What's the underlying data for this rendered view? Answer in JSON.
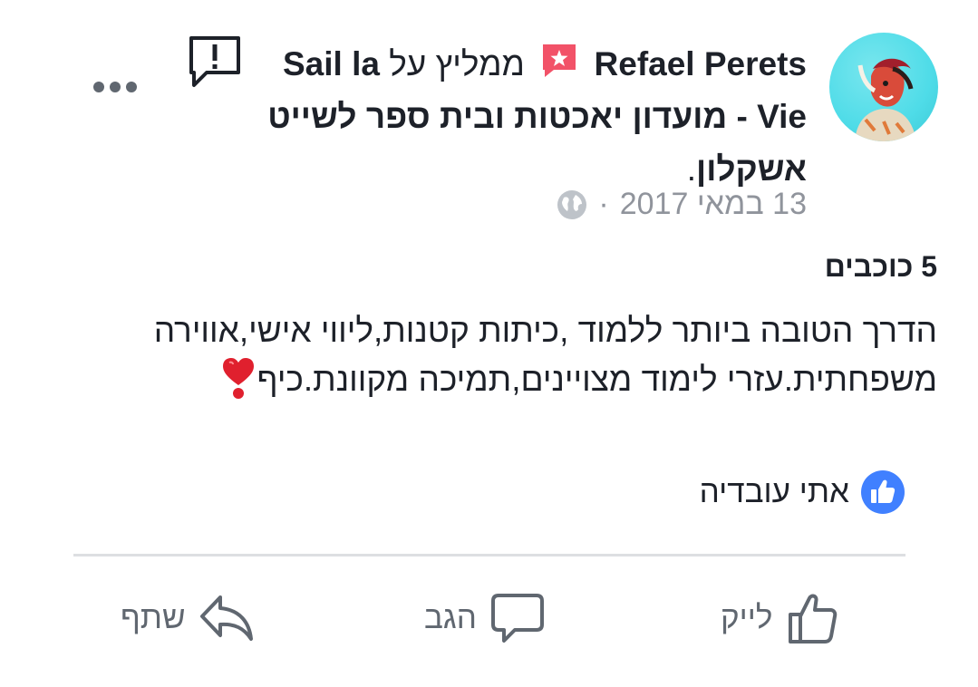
{
  "post": {
    "author": "Refael Perets",
    "recommends": "ממליץ על",
    "page_name": "Sail la Vie - מועדון יאכטות ובית ספר לשייט אשקלון",
    "period": ".",
    "date": "13 במאי 2017",
    "separator": "·",
    "rating": "5 כוכבים",
    "body_line1": "הדרך הטובה ביותר ללמוד ,כיתות קטנות,ליווי אישי,אווירה",
    "body_line2": "משפחתית.עזרי לימוד מצויינים,תמיכה מקוונת.כיף",
    "heart_emoji": "❣️",
    "liked_by": "אתי עובדיה"
  },
  "actions": {
    "like_label": "לייק",
    "comment_label": "הגב",
    "share_label": "שתף"
  },
  "colors": {
    "text": "#1d2129",
    "meta": "#90949c",
    "recommend_badge": "#f25268",
    "like_blue": "#4080ff",
    "icon_gray": "#606770"
  },
  "icons": {
    "menu": "more-options-icon",
    "report": "report-icon",
    "badge": "recommendation-badge-icon",
    "privacy": "globe-icon",
    "reaction": "like-reaction-icon"
  }
}
